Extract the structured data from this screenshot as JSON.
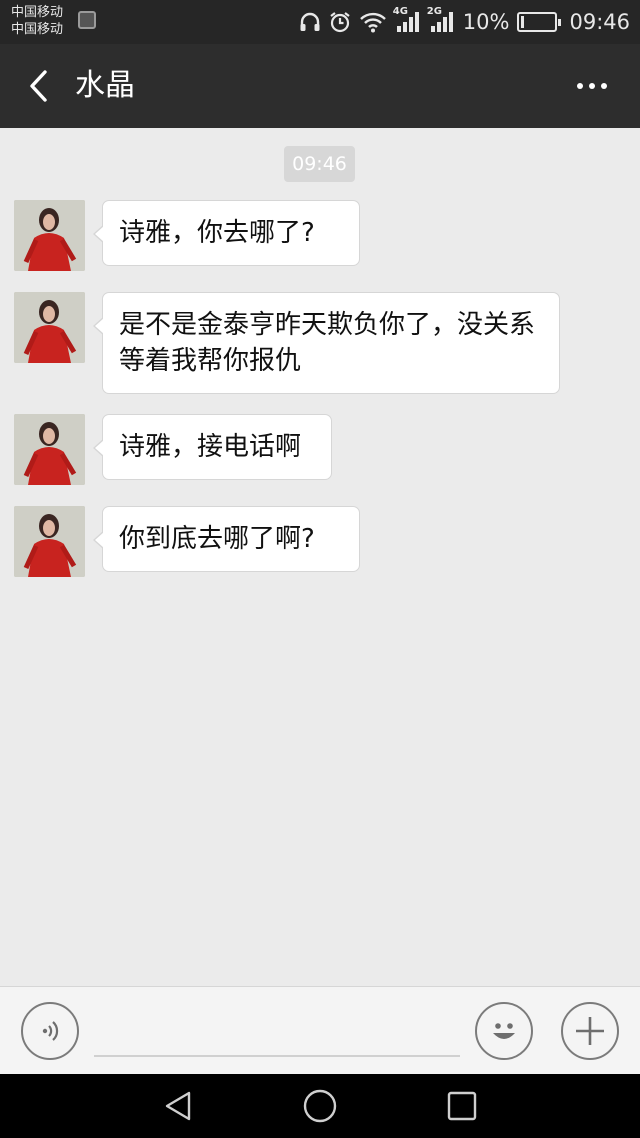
{
  "status_bar": {
    "carrier_1": "中国移动",
    "carrier_2": "中国移动",
    "network_1": "4G",
    "network_2": "2G",
    "battery": "10%",
    "battery_level": 0.1,
    "time": "09:46"
  },
  "header": {
    "title": "水晶",
    "back_icon": "chevron-left-icon",
    "more_icon": "more-dots-icon"
  },
  "chat": {
    "timestamp": "09:46",
    "messages": [
      {
        "text": "诗雅，你去哪了?"
      },
      {
        "text": "是不是金泰亨昨天欺负你了，没关系等着我帮你报仇"
      },
      {
        "text": "诗雅，接电话啊"
      },
      {
        "text": "你到底去哪了啊?"
      }
    ]
  },
  "input_bar": {
    "voice_icon": "voice-icon",
    "emoji_icon": "smiley-icon",
    "plus_icon": "plus-icon",
    "placeholder": ""
  },
  "colors": {
    "header_bg": "#2d2d2d",
    "chat_bg": "#ebebeb",
    "bubble_bg": "#ffffff",
    "avatar_accent": "#c8231f"
  }
}
